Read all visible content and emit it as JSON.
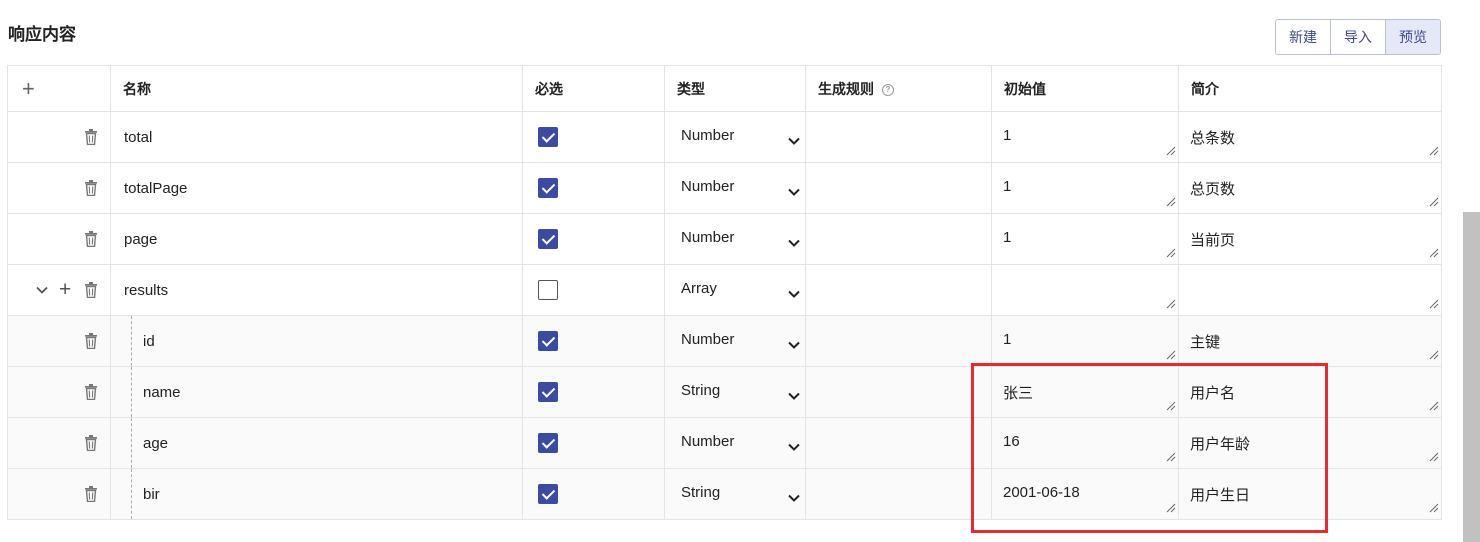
{
  "title": "响应内容",
  "toolbar": {
    "new_label": "新建",
    "import_label": "导入",
    "preview_label": "预览"
  },
  "columns": {
    "add": "+",
    "name": "名称",
    "required": "必选",
    "type": "类型",
    "rule": "生成规则",
    "rule_help": "?",
    "initial": "初始值",
    "desc": "简介"
  },
  "rows": [
    {
      "name": "total",
      "required": true,
      "type": "Number",
      "initial": "1",
      "desc": "总条数"
    },
    {
      "name": "totalPage",
      "required": true,
      "type": "Number",
      "initial": "1",
      "desc": "总页数"
    },
    {
      "name": "page",
      "required": true,
      "type": "Number",
      "initial": "1",
      "desc": "当前页"
    },
    {
      "name": "results",
      "required": false,
      "type": "Array",
      "initial": "",
      "desc": ""
    },
    {
      "name": "id",
      "required": true,
      "type": "Number",
      "initial": "1",
      "desc": "主键"
    },
    {
      "name": "name",
      "required": true,
      "type": "String",
      "initial": "张三",
      "desc": "用户名"
    },
    {
      "name": "age",
      "required": true,
      "type": "Number",
      "initial": "16",
      "desc": "用户年龄"
    },
    {
      "name": "bir",
      "required": true,
      "type": "String",
      "initial": "2001-06-18",
      "desc": "用户生日"
    }
  ],
  "colors": {
    "accent": "#3b4ba4",
    "highlight": "#e52b34"
  }
}
